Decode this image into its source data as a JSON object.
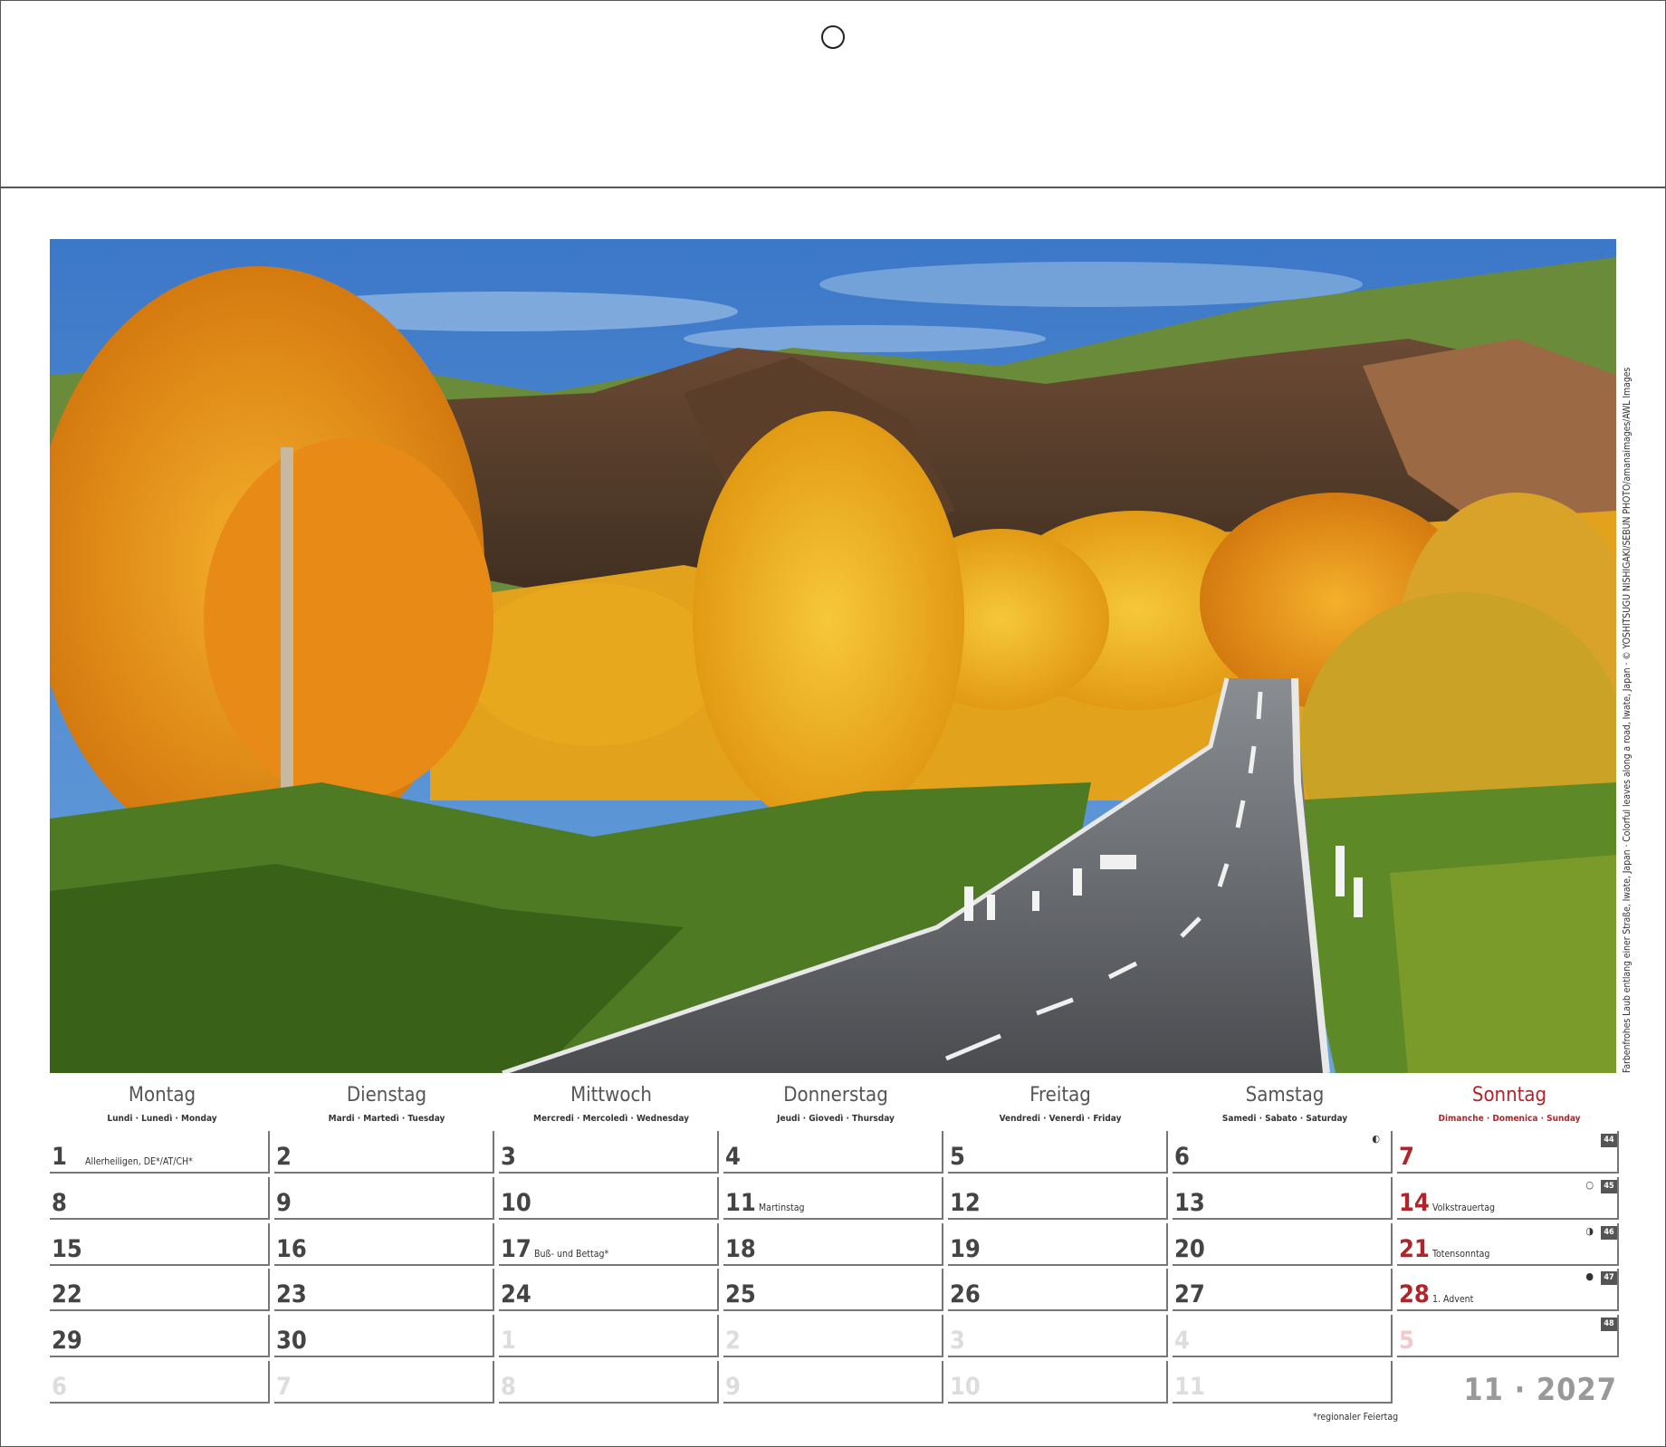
{
  "photo": {
    "alt": "Autumn road through golden birch trees",
    "credit": "Farbenfrohes Laub entlang einer Straße, Iwate, Japan · Colorful leaves along a road, Iwate, Japan · © YOSHITSUGU NISHIGAKI/SEBUN PHOTO/amanaimages/AWL Images"
  },
  "weekdays": [
    {
      "name": "Montag",
      "sub": "Lundi · Lunedì · Monday"
    },
    {
      "name": "Dienstag",
      "sub": "Mardi · Martedì · Tuesday"
    },
    {
      "name": "Mittwoch",
      "sub": "Mercredi · Mercoledì · Wednesday"
    },
    {
      "name": "Donnerstag",
      "sub": "Jeudi · Giovedì · Thursday"
    },
    {
      "name": "Freitag",
      "sub": "Vendredi · Venerdì · Friday"
    },
    {
      "name": "Samstag",
      "sub": "Samedi · Sabato · Saturday"
    },
    {
      "name": "Sonntag",
      "sub": "Dimanche · Domenica · Sunday"
    }
  ],
  "weeks": [
    {
      "week_no": "44",
      "days": [
        {
          "n": "1",
          "note": "Allerheiligen, DE*/AT/CH*"
        },
        {
          "n": "2"
        },
        {
          "n": "3"
        },
        {
          "n": "4"
        },
        {
          "n": "5"
        },
        {
          "n": "6",
          "moon": "◐"
        },
        {
          "n": "7"
        }
      ]
    },
    {
      "week_no": "45",
      "days": [
        {
          "n": "8"
        },
        {
          "n": "9"
        },
        {
          "n": "10"
        },
        {
          "n": "11",
          "note": "Martinstag"
        },
        {
          "n": "12"
        },
        {
          "n": "13"
        },
        {
          "n": "14",
          "note": "Volkstrauertag",
          "moon": "○"
        }
      ]
    },
    {
      "week_no": "46",
      "days": [
        {
          "n": "15"
        },
        {
          "n": "16"
        },
        {
          "n": "17",
          "note": "Buß- und Bettag*"
        },
        {
          "n": "18"
        },
        {
          "n": "19"
        },
        {
          "n": "20"
        },
        {
          "n": "21",
          "note": "Totensonntag",
          "moon": "◑"
        }
      ]
    },
    {
      "week_no": "47",
      "days": [
        {
          "n": "22"
        },
        {
          "n": "23"
        },
        {
          "n": "24"
        },
        {
          "n": "25"
        },
        {
          "n": "26"
        },
        {
          "n": "27"
        },
        {
          "n": "28",
          "note": "1. Advent",
          "moon": "●"
        }
      ]
    },
    {
      "week_no": "48",
      "days": [
        {
          "n": "29"
        },
        {
          "n": "30"
        },
        {
          "n": "1",
          "faded": true
        },
        {
          "n": "2",
          "faded": true
        },
        {
          "n": "3",
          "faded": true
        },
        {
          "n": "4",
          "faded": true
        },
        {
          "n": "5",
          "faded": true
        }
      ]
    },
    {
      "week_no": "",
      "days": [
        {
          "n": "6",
          "faded": true
        },
        {
          "n": "7",
          "faded": true
        },
        {
          "n": "8",
          "faded": true
        },
        {
          "n": "9",
          "faded": true
        },
        {
          "n": "10",
          "faded": true
        },
        {
          "n": "11",
          "faded": true
        }
      ]
    }
  ],
  "month_year": "11 · 2027",
  "footnote": "*regionaler Feiertag",
  "colors": {
    "sunday": "#b3242a",
    "grid": "#777777",
    "week_badge": "#555555"
  }
}
